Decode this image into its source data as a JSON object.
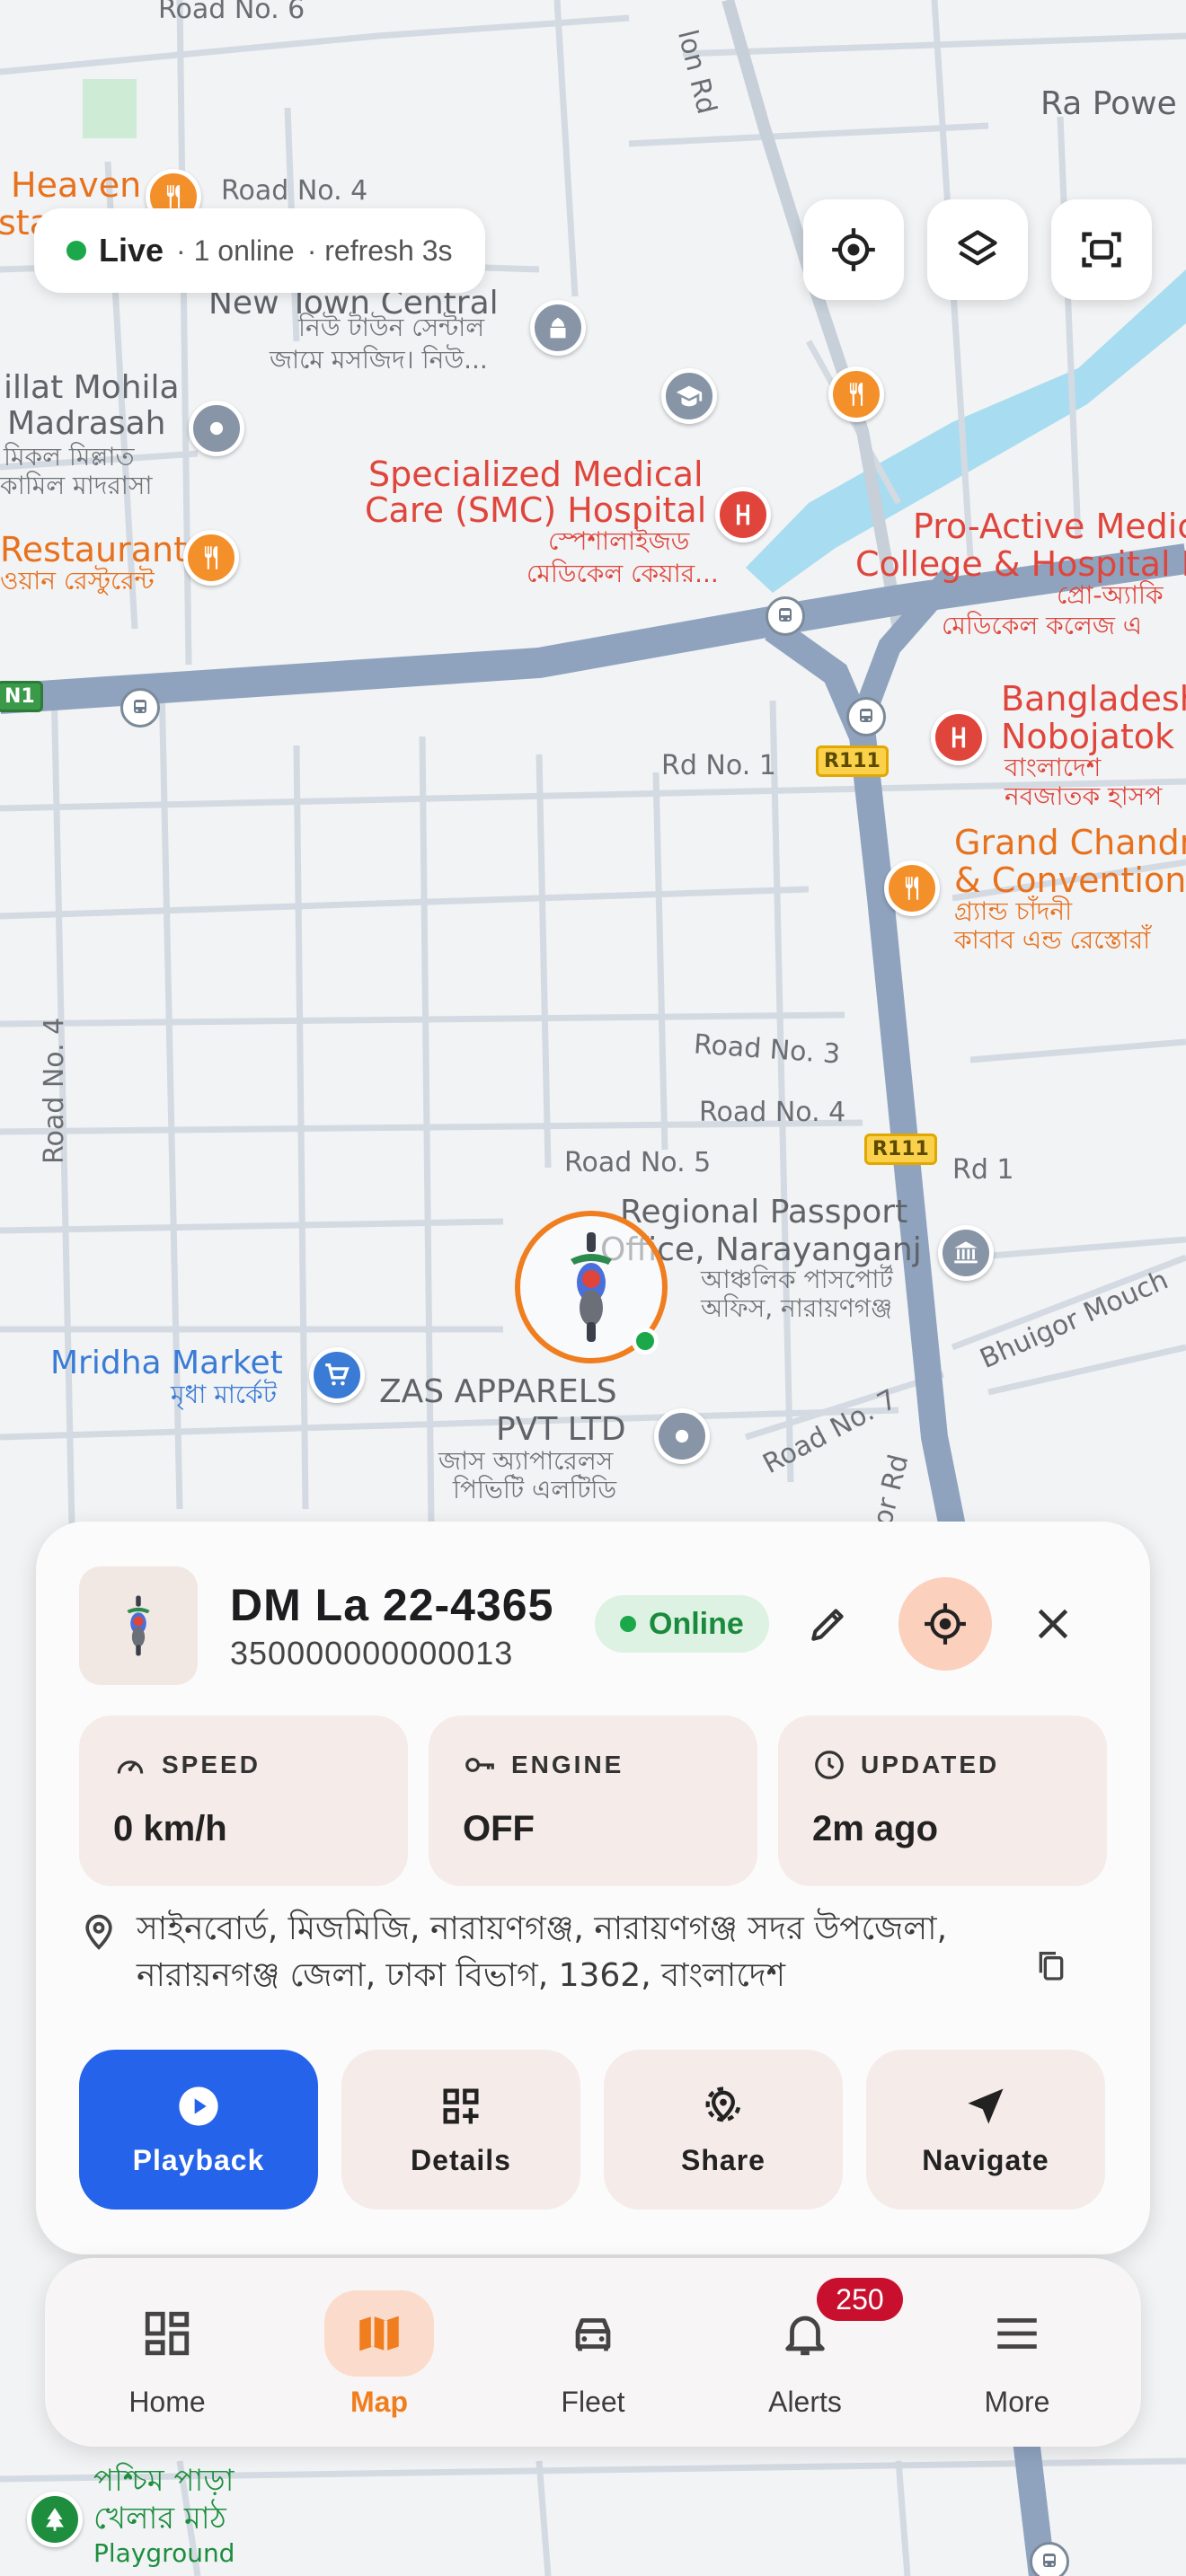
{
  "map": {
    "labels": {
      "road_no_6": "Road No. 6",
      "lon_rd": "lon Rd",
      "ra_power": "Ra Powe",
      "heaven": "Heaven",
      "staurant": "staurant",
      "road_no_4_top": "Road No. 4",
      "new_town_central": "New Town Central",
      "new_town_bn_1": "নিউ টাউন সেন্টাল",
      "new_town_bn_2": "জামে মসজিদ। নিউ...",
      "illat_mohila": "illat Mohila",
      "madrasah": "Madrasah",
      "madrasah_bn_1": "মিকল মিল্লাত",
      "madrasah_bn_2": "কামিল মাদরাসা",
      "smc_1": "Specialized Medical",
      "smc_2": "Care (SMC) Hospital",
      "smc_bn_1": "স্পেশালাইজড",
      "smc_bn_2": "মেডিকেল কেয়ার...",
      "restaurant": "Restaurant",
      "restaurant_bn": "ওয়ান রেস্টুরেন্ট",
      "proactive_1": "Pro-Active Medic",
      "proactive_2": "College & Hospital L",
      "proactive_bn_1": "প্রো-অ্যাকি",
      "proactive_bn_2": "মেডিকেল কলেজ এ",
      "rd_no_1": "Rd No. 1",
      "bangladesh_1": "Bangladesh",
      "bangladesh_2": "Nobojatok H",
      "bangladesh_bn_1": "বাংলাদেশ",
      "bangladesh_bn_2": "নবজাতক হাসপ",
      "grand_1": "Grand Chandr",
      "grand_2": "& Convention",
      "grand_bn_1": "গ্র্যান্ড চাঁদনী",
      "grand_bn_2": "কাবাব এন্ড রেস্তোরাঁ",
      "road_no_4_left": "Road No. 4",
      "road_no_3": "Road No. 3",
      "road_no_4_mid": "Road No. 4",
      "road_no_5": "Road No. 5",
      "rd_1": "Rd 1",
      "passport_1": "Regional Passport",
      "passport_2": "Office, Narayanganj",
      "passport_bn_1": "আঞ্চলিক পাসপোর্ট",
      "passport_bn_2": "অফিস, নারায়ণগঞ্জ",
      "bhuigor": "Bhuigor Mouch",
      "mridha_1": "Mridha Market",
      "mridha_bn": "মৃধা মার্কেট",
      "zas_1": "ZAS APPARELS",
      "zas_2": "PVT LTD",
      "zas_bn_1": "জাস অ্যাপারেলস",
      "zas_bn_2": "পিভিটি এলটিডি",
      "road_no_7": "Road No. 7",
      "or_rd": "or Rd",
      "playground_bn_1": "পশ্চিম পাড়া",
      "playground_bn_2": "খেলার মাঠ",
      "playground": "Playground",
      "shield_r111_a": "R111",
      "shield_r111_b": "R111",
      "shield_n1": "N1"
    }
  },
  "live_chip": {
    "label": "Live",
    "online": "· 1 online",
    "refresh": "· refresh 3s"
  },
  "map_controls": {
    "locate_icon": "crosshair-icon",
    "layers_icon": "layers-icon",
    "fit_icon": "fit-screen-icon"
  },
  "vehicle": {
    "plate": "DM La 22-4365",
    "imei": "350000000000013",
    "status": "Online",
    "status_color": "#1aa84b",
    "marker_color": "#f07d1e"
  },
  "stats": [
    {
      "label": "SPEED",
      "value": "0 km/h",
      "icon": "speedometer-icon"
    },
    {
      "label": "ENGINE",
      "value": "OFF",
      "icon": "key-icon"
    },
    {
      "label": "UPDATED",
      "value": "2m ago",
      "icon": "clock-icon"
    }
  ],
  "address": {
    "line1": "সাইনবোর্ড, মিজমিজি, নারায়ণগঞ্জ, নারায়ণগঞ্জ সদর উপজেলা,",
    "line2": "নারায়নগঞ্জ জেলা, ঢাকা বিভাগ, 1362, বাংলাদেশ"
  },
  "actions": [
    {
      "label": "Playback",
      "icon": "play-icon"
    },
    {
      "label": "Details",
      "icon": "grid-add-icon"
    },
    {
      "label": "Share",
      "icon": "share-location-icon"
    },
    {
      "label": "Navigate",
      "icon": "navigate-arrow-icon"
    }
  ],
  "nav": {
    "items": [
      {
        "label": "Home",
        "icon": "dashboard-icon"
      },
      {
        "label": "Map",
        "icon": "map-icon"
      },
      {
        "label": "Fleet",
        "icon": "car-icon"
      },
      {
        "label": "Alerts",
        "icon": "bell-icon",
        "badge": "250"
      },
      {
        "label": "More",
        "icon": "menu-icon"
      }
    ],
    "active": "Map",
    "accent": "#f07d1e",
    "badge_color": "#c8102e"
  },
  "colors": {
    "primary": "#2563eb",
    "card_bg": "#f5ebe8"
  }
}
